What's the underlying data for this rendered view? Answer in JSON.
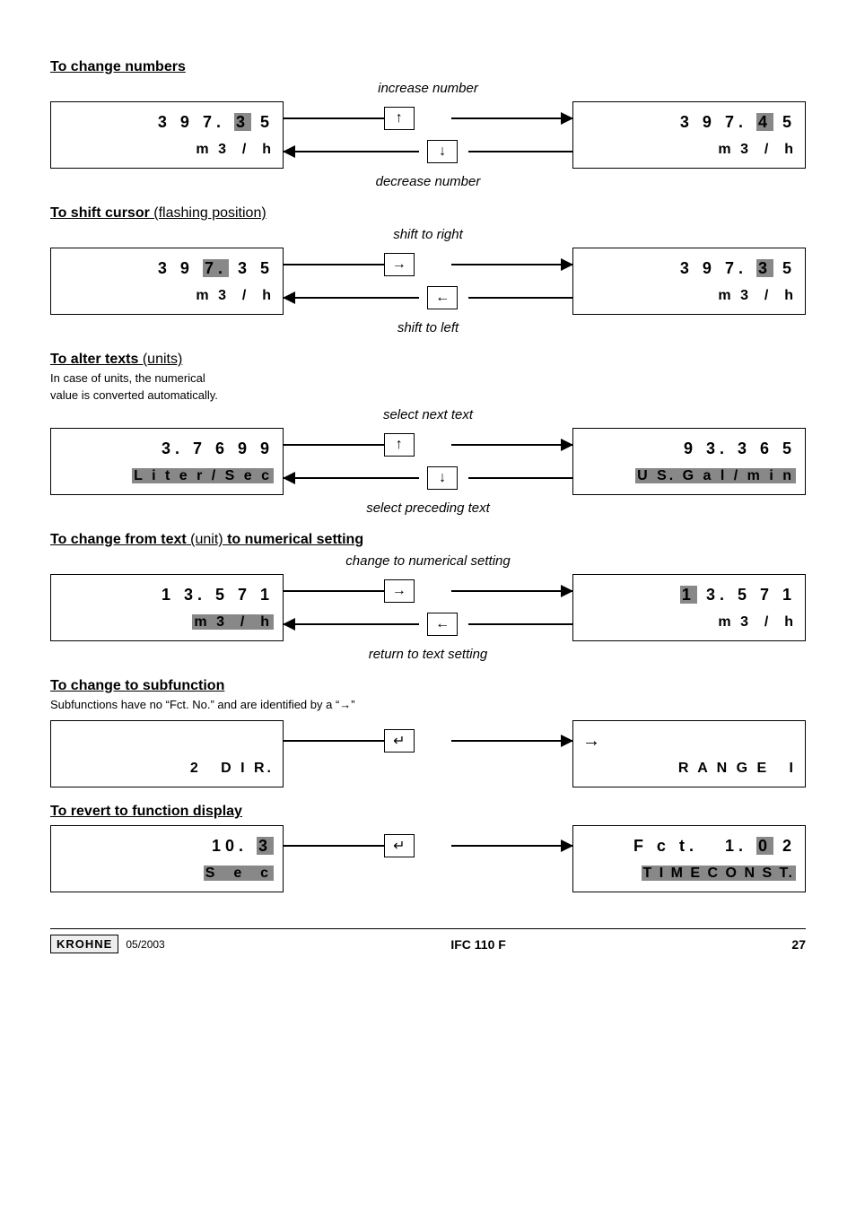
{
  "sections": {
    "change_numbers": {
      "heading": "To change numbers",
      "cap_top": "increase number",
      "cap_bottom": "decrease number",
      "left_l1_a": "3 9 7. ",
      "left_l1_b": "3",
      "left_l1_c": " 5",
      "left_l2": "m 3  /  h",
      "right_l1_a": "3 9 7. ",
      "right_l1_b": "4",
      "right_l1_c": " 5",
      "right_l2": "m 3  /  h",
      "key_top": "↑",
      "key_bottom": "↓"
    },
    "shift_cursor": {
      "heading": "To shift cursor",
      "heading_paren": " (flashing position)",
      "cap_top": "shift to right",
      "cap_bottom": "shift to left",
      "left_l1_a": "3 9 ",
      "left_l1_b": "7.",
      "left_l1_c": " 3 5",
      "left_l2": "m 3  /  h",
      "right_l1_a": "3 9 7. ",
      "right_l1_b": "3",
      "right_l1_c": " 5",
      "right_l2": "m 3  /  h",
      "key_top": "→",
      "key_bottom": "←"
    },
    "alter_texts": {
      "heading": "To alter texts",
      "heading_paren": " (units)",
      "note1": "In case of units, the numerical",
      "note2": "value is converted automatically.",
      "cap_top": "select next text",
      "cap_bottom": "select preceding text",
      "left_l1": "3. 7 6 9 9",
      "left_l2": "L i t e r / S e c",
      "right_l1": "9 3. 3 6 5",
      "right_l2": "U S. G a l / m i n",
      "key_top": "↑",
      "key_bottom": "↓"
    },
    "text_to_num": {
      "heading": "To change from text",
      "heading_mid": " (unit) ",
      "heading2": "to numerical setting",
      "cap_top": "change to numerical setting",
      "cap_bottom": "return to text setting",
      "left_l1": "1 3. 5 7 1",
      "left_l2": "m 3  /  h",
      "right_l1_a": "1",
      "right_l1_b": " 3. 5 7 1",
      "right_l2": "m 3  /  h",
      "key_top": "→",
      "key_bottom": "←"
    },
    "subfunction": {
      "heading": "To change to subfunction",
      "note": "Subfunctions have no “Fct. No.” and are identified by a “→”",
      "left_l2": "2   D I R.",
      "right_l1": "→",
      "right_l2": "R A N G E   I",
      "key": "↵"
    },
    "revert": {
      "heading": "To revert to function display",
      "left_l1_a": "10. ",
      "left_l1_b": "3",
      "left_l2": "S  e  c",
      "right_l1_a": "F c t.   1. ",
      "right_l1_b": "0",
      "right_l1_c": " 2",
      "right_l2": "T I M E C O N S T.",
      "key": "↵"
    }
  },
  "footer": {
    "brand": "KROHNE",
    "date": "05/2003",
    "title": "IFC 110 F",
    "page": "27"
  }
}
